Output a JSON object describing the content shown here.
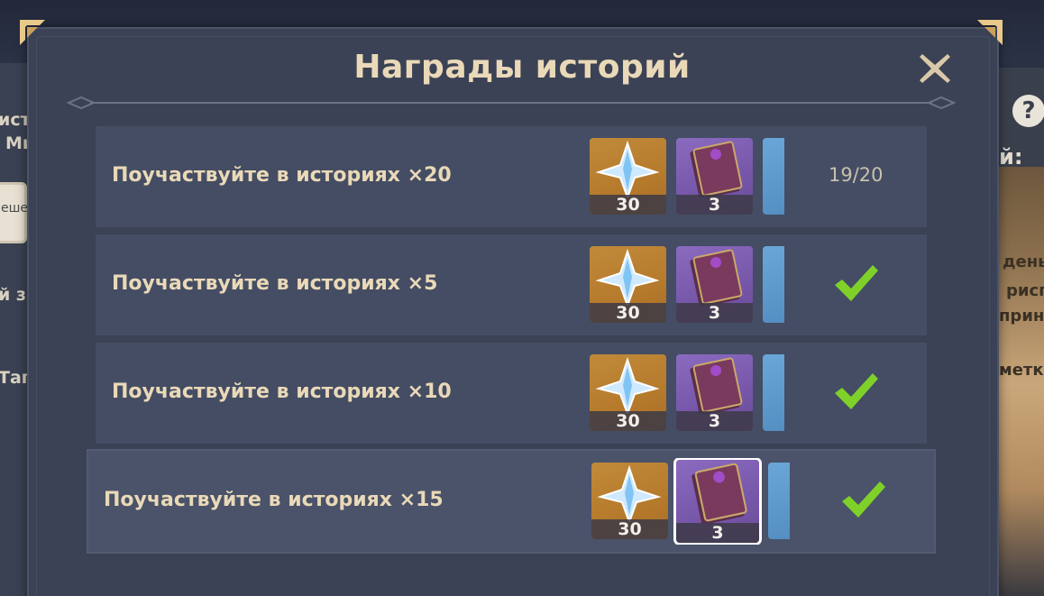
{
  "modal": {
    "title": "Награды историй",
    "close_icon": "close-x-icon"
  },
  "background": {
    "left_texts": [
      "ист",
      "Ми",
      "ешеі",
      "й за",
      "Таг"
    ],
    "right_texts": [
      "й:",
      "день",
      "рисп",
      "прин",
      "метк"
    ],
    "help_icon": "?"
  },
  "rows": [
    {
      "label": "Поучаствуйте в историях ×20",
      "status": "19/20",
      "completed": false,
      "rewards": [
        {
          "icon": "primogem-icon",
          "count": "30"
        },
        {
          "icon": "book-icon",
          "count": "3"
        }
      ]
    },
    {
      "label": "Поучаствуйте в историях ×5",
      "status": "",
      "completed": true,
      "rewards": [
        {
          "icon": "primogem-icon",
          "count": "30"
        },
        {
          "icon": "book-icon",
          "count": "3"
        }
      ]
    },
    {
      "label": "Поучаствуйте в историях ×10",
      "status": "",
      "completed": true,
      "rewards": [
        {
          "icon": "primogem-icon",
          "count": "30"
        },
        {
          "icon": "book-icon",
          "count": "3"
        }
      ]
    },
    {
      "label": "Поучаствуйте в историях ×15",
      "status": "",
      "completed": true,
      "rewards": [
        {
          "icon": "primogem-icon",
          "count": "30"
        },
        {
          "icon": "book-icon",
          "count": "3"
        }
      ]
    }
  ],
  "colors": {
    "title": "#ead9b8",
    "panel": "#3b4255",
    "row": "#444d63",
    "check": "#7fd12a"
  }
}
